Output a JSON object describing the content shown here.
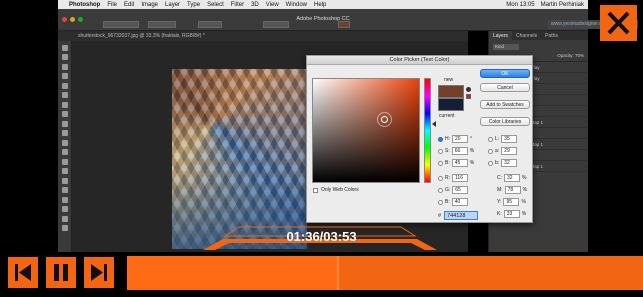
{
  "menubar": {
    "items": [
      "Photoshop",
      "File",
      "Edit",
      "Image",
      "Layer",
      "Type",
      "Select",
      "Filter",
      "3D",
      "View",
      "Window",
      "Help"
    ],
    "clock": "Mon 13:05",
    "user": "Martin Perhiniak"
  },
  "app": {
    "window_title": "Adobe Photoshop CC",
    "website": "www.yesimadesigner.com"
  },
  "document": {
    "tab": "shutterstock_96732037.jpg @ 33.3% (fraktals, RGB/8#) *",
    "zoom_status": "33.33%",
    "doc_status": "Doc: 3.74M/33.2M"
  },
  "panels": {
    "tabs": [
      "Layers",
      "Channels",
      "Paths"
    ],
    "kind": "Kind",
    "opacity": "Opacity: 70%",
    "fill": "Fill: 100%",
    "layers": [
      "Color Overlay",
      "Color Overlay",
      "fraktals",
      "copy 2",
      "Layer 1",
      "Gradient Map 1",
      "copy 2",
      "Gradient Map 1",
      "fraktals",
      "Gradient Map 1"
    ]
  },
  "color_picker": {
    "title": "Color Picker (Text Color)",
    "new_label": "new",
    "current_label": "current",
    "new_color": "#744128",
    "current_color": "#141e36",
    "buttons": {
      "ok": "OK",
      "cancel": "Cancel",
      "add_to_swatches": "Add to Swatches",
      "color_libraries": "Color Libraries"
    },
    "only_web_colors": "Only Web Colors",
    "hsb": [
      {
        "label": "H:",
        "value": "20",
        "unit": "°"
      },
      {
        "label": "S:",
        "value": "66",
        "unit": "%"
      },
      {
        "label": "B:",
        "value": "45",
        "unit": "%"
      }
    ],
    "rgb": [
      {
        "label": "R:",
        "value": "116"
      },
      {
        "label": "G:",
        "value": "65"
      },
      {
        "label": "B:",
        "value": "40"
      }
    ],
    "lab": [
      {
        "label": "L:",
        "value": "35"
      },
      {
        "label": "a:",
        "value": "29"
      },
      {
        "label": "b:",
        "value": "32"
      }
    ],
    "cmyk": [
      {
        "label": "C:",
        "value": "32",
        "unit": "%"
      },
      {
        "label": "M:",
        "value": "78",
        "unit": "%"
      },
      {
        "label": "Y:",
        "value": "95",
        "unit": "%"
      },
      {
        "label": "K:",
        "value": "33",
        "unit": "%"
      }
    ],
    "hex_label": "#",
    "hex": "744128"
  },
  "player": {
    "timer": "01:36/03:53",
    "progress_fraction": 0.41,
    "accent": "#f26513",
    "icons": [
      "skip-back-icon",
      "pause-icon",
      "skip-forward-icon",
      "close-icon"
    ]
  }
}
